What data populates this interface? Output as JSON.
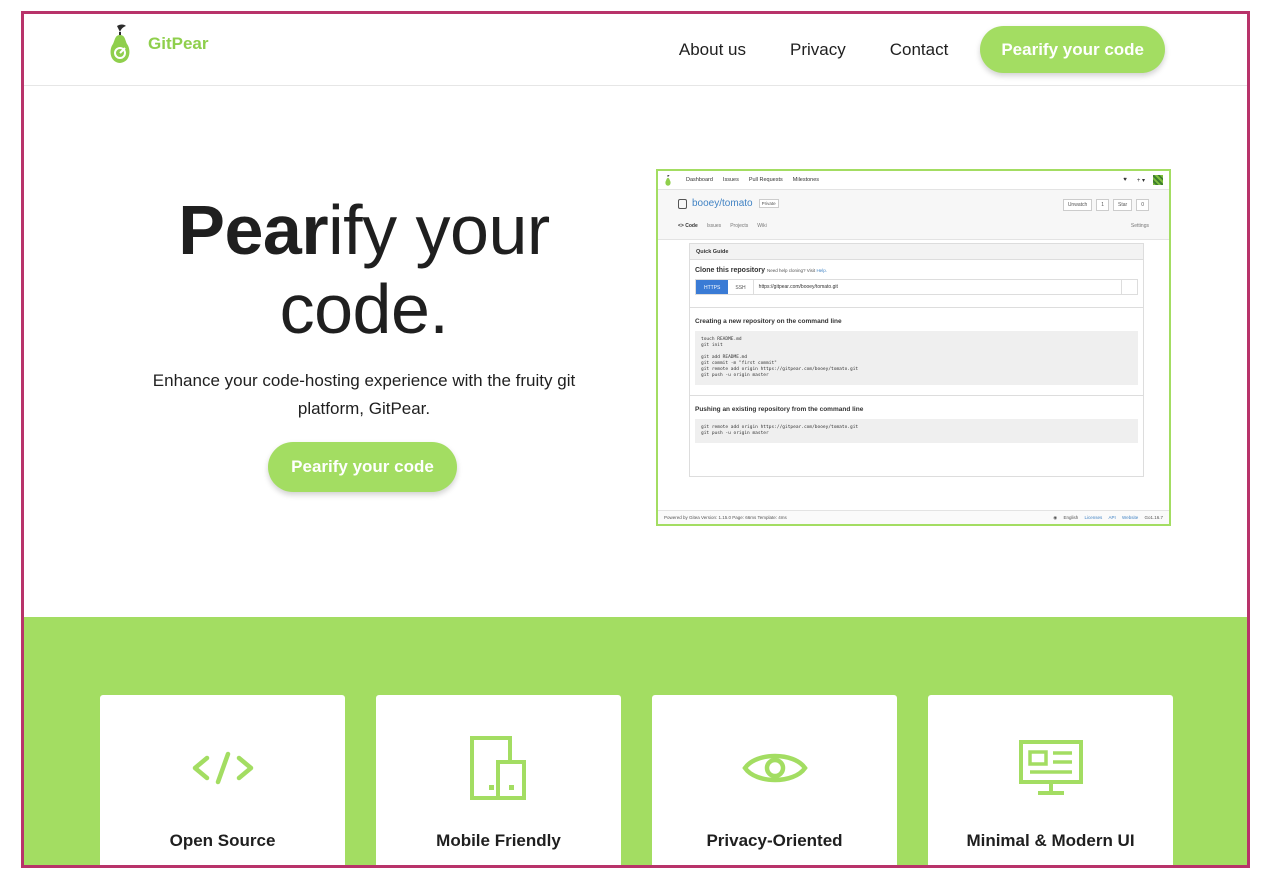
{
  "nav": {
    "brand": "GitPear",
    "links": [
      "About us",
      "Privacy",
      "Contact"
    ],
    "cta": "Pearify your code"
  },
  "hero": {
    "title_bold": "Pear",
    "title_rest": "ify your",
    "title_line2": "code.",
    "subtitle": "Enhance your code-hosting experience with the fruity git platform, GitPear.",
    "cta": "Pearify your code"
  },
  "screenshot": {
    "topnav": [
      "Dashboard",
      "Issues",
      "Pull Requests",
      "Milestones"
    ],
    "owner": "booey",
    "separator": "/",
    "repo": "tomato",
    "private_badge": "Private",
    "unwatch_label": "Unwatch",
    "unwatch_count": "1",
    "star_label": "Star",
    "star_count": "0",
    "tabs": [
      "<> Code",
      "Issues",
      "Projects",
      "Wiki"
    ],
    "settings": "Settings",
    "quick_guide": "Quick Guide",
    "clone_title": "Clone this repository",
    "clone_help": "Need help cloning? Visit",
    "clone_help_link": "Help.",
    "https": "HTTPS",
    "ssh": "SSH",
    "clone_url": "https://gitpear.com/booey/tomato.git",
    "new_repo_title": "Creating a new repository on the command line",
    "new_repo_code": "touch README.md\ngit init\n\ngit add README.md\ngit commit -m \"first commit\"\ngit remote add origin https://gitpear.com/booey/tomato.git\ngit push -u origin master",
    "push_title": "Pushing an existing repository from the command line",
    "push_code": "git remote add origin https://gitpear.com/booey/tomato.git\ngit push -u origin master",
    "footer_left": "Powered by Gitea Version: 1.15.0 Page: 66ms Template: 4ms",
    "footer_links": [
      "English",
      "Licenses",
      "API",
      "Website",
      "Go1.16.7"
    ]
  },
  "features": [
    {
      "title": "Open Source",
      "icon": "code-icon"
    },
    {
      "title": "Mobile Friendly",
      "icon": "devices-icon"
    },
    {
      "title": "Privacy-Oriented",
      "icon": "eye-icon"
    },
    {
      "title": "Minimal & Modern UI",
      "icon": "monitor-icon"
    }
  ],
  "colors": {
    "accent": "#a3dd62",
    "brand_text": "#8fcf4c",
    "frame_border": "#b8336a",
    "link_blue": "#4183c4"
  }
}
